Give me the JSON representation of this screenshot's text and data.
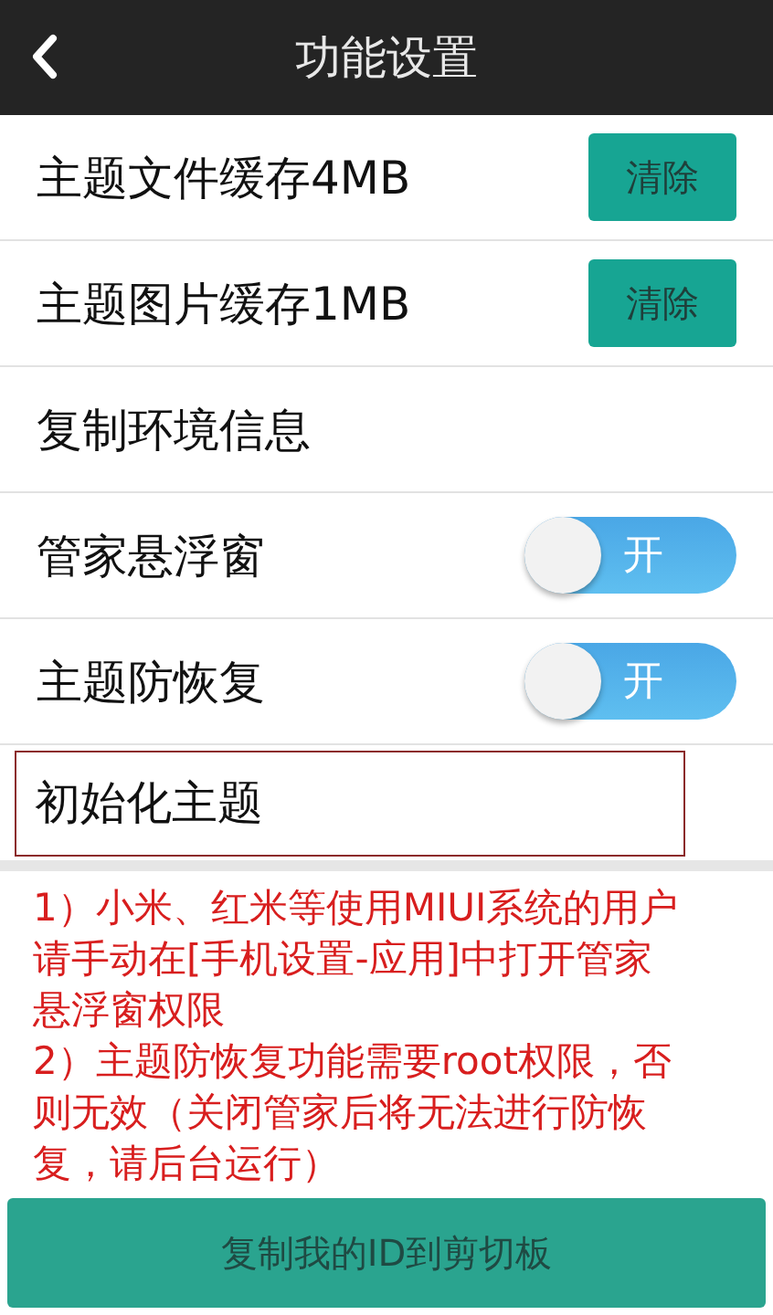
{
  "header": {
    "title": "功能设置"
  },
  "rows": [
    {
      "kind": "action",
      "label": "主题文件缓存4MB",
      "button": "清除"
    },
    {
      "kind": "action",
      "label": "主题图片缓存1MB",
      "button": "清除"
    },
    {
      "kind": "plain",
      "label": "复制环境信息"
    },
    {
      "kind": "toggle",
      "label": "管家悬浮窗",
      "on": true,
      "toggle_label": "开"
    },
    {
      "kind": "toggle",
      "label": "主题防恢复",
      "on": true,
      "toggle_label": "开"
    },
    {
      "kind": "highlighted",
      "label": "初始化主题"
    }
  ],
  "notes": [
    "1）小米、红米等使用MIUI系统的用户",
    "请手动在[手机设置-应用]中打开管家",
    "悬浮窗权限",
    "2）主题防恢复功能需要root权限，否",
    "则无效（关闭管家后将无法进行防恢",
    "复，请后台运行）"
  ],
  "copy_button": "复制我的ID到剪切板"
}
